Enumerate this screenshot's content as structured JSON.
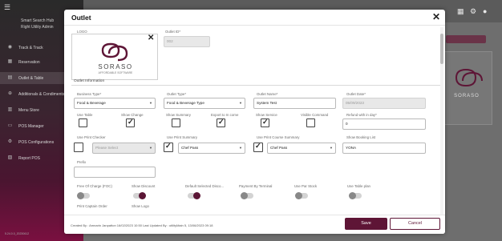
{
  "app": {
    "name": "Smart Search Hub",
    "user": "Right Utility Admin",
    "version": "5.24.0.0_20230612"
  },
  "sidebar": {
    "items": [
      {
        "label": "Track & Track",
        "icon": "pin-icon"
      },
      {
        "label": "Reservation",
        "icon": "calendar-icon"
      },
      {
        "label": "Outlet & Table",
        "icon": "table-icon"
      },
      {
        "label": "Additionals & Condiments",
        "icon": "plus-icon"
      },
      {
        "label": "Menu Store",
        "icon": "book-icon"
      },
      {
        "label": "POS Manager",
        "icon": "monitor-icon"
      },
      {
        "label": "POS Configurations",
        "icon": "gear-icon"
      },
      {
        "label": "Report POS",
        "icon": "report-icon"
      }
    ]
  },
  "modal": {
    "title": "Outlet",
    "logo_label": "LOGO",
    "logo_brand": "SORASO",
    "logo_tagline": "AFFORDABLE SOFTWARE",
    "outlet_id_label": "Outlet ID*",
    "outlet_id_value": "002",
    "section_title": "Outlet Information",
    "fields": {
      "business_type": {
        "label": "Business Type*",
        "value": "Food & Beverage"
      },
      "outlet_type": {
        "label": "Outlet Type*",
        "value": "Food & Beverage Type"
      },
      "outlet_name": {
        "label": "Outlet Name*",
        "value": "System Test"
      },
      "outlet_date": {
        "label": "Outlet Date*",
        "value": "05/09/2023"
      },
      "refund_within": {
        "label": "Refund with in day*",
        "value": "0"
      },
      "use_print_checker": {
        "label": "Use Print Checker",
        "value": "Please Select"
      },
      "use_print_summary": {
        "label": "Use Print Summary",
        "value": "Chef Pass"
      },
      "use_print_course_summary": {
        "label": "Use Print Course Summary",
        "value": "Chef Pass"
      },
      "show_booking_list": {
        "label": "Show Booking List",
        "value": "YONA"
      },
      "prefix": {
        "label": "Prefix",
        "value": ""
      }
    },
    "checks": [
      {
        "label": "Use Table",
        "checked": false
      },
      {
        "label": "Show Change",
        "checked": true
      },
      {
        "label": "Show Summary",
        "checked": false
      },
      {
        "label": "Export to In come",
        "checked": true
      },
      {
        "label": "Show Service",
        "checked": true
      },
      {
        "label": "Visible Command",
        "checked": false
      }
    ],
    "toggles": [
      {
        "label": "Free Of Charge (FOC)",
        "on": false
      },
      {
        "label": "Show Discount",
        "on": true
      },
      {
        "label": "Default Selected Disco...",
        "on": true
      },
      {
        "label": "Payment By Terminal",
        "on": false
      },
      {
        "label": "Use Par Stock",
        "on": false
      },
      {
        "label": "Use Table plan",
        "on": false
      }
    ],
    "extra_labels": {
      "print_captain_order": "Print Captain Order",
      "show_logo": "Show Logo"
    },
    "footer_info": "Created By : Amnarin Janpatton 16/02/2023 10:50   Last Updated By : utilityMain 5, 13/06/2023 09:18",
    "save_label": "Save",
    "cancel_label": "Cancel"
  },
  "background": {
    "card_brand": "SORASO"
  },
  "colors": {
    "primary": "#5e1536",
    "sidebar_gradient_end": "#7a1040"
  }
}
